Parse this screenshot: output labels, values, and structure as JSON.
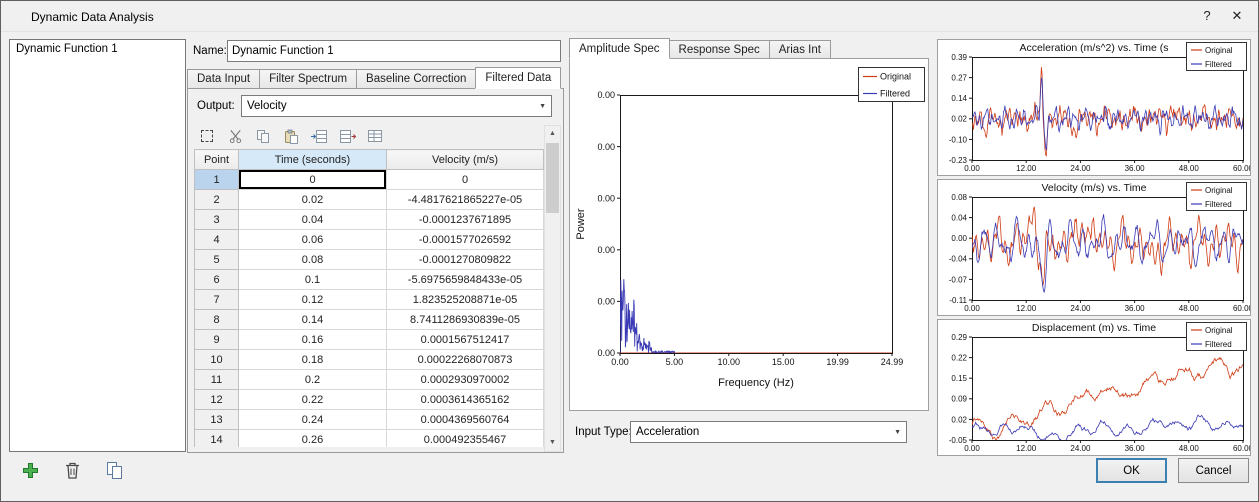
{
  "window": {
    "title": "Dynamic Data Analysis",
    "help": "?",
    "close": "✕"
  },
  "icons": {
    "chevron_down": "▼",
    "scroll_up": "▲",
    "scroll_down": "▼"
  },
  "sidebar": {
    "items": [
      {
        "label": "Dynamic Function 1"
      }
    ]
  },
  "form": {
    "name_label": "Name:",
    "name_value": "Dynamic Function 1",
    "tabs": [
      {
        "label": "Data Input"
      },
      {
        "label": "Filter Spectrum"
      },
      {
        "label": "Baseline Correction"
      },
      {
        "label": "Filtered Data"
      }
    ],
    "active_tab": "Filtered Data",
    "output_label": "Output:",
    "output_value": "Velocity"
  },
  "table": {
    "columns": [
      "Point",
      "Time (seconds)",
      "Velocity (m/s)"
    ],
    "rows": [
      [
        "1",
        "0",
        "0"
      ],
      [
        "2",
        "0.02",
        "-4.4817621865227e-05"
      ],
      [
        "3",
        "0.04",
        "-0.0001237671895"
      ],
      [
        "4",
        "0.06",
        "-0.0001577026592"
      ],
      [
        "5",
        "0.08",
        "-0.0001270809822"
      ],
      [
        "6",
        "0.1",
        "-5.6975659848433e-05"
      ],
      [
        "7",
        "0.12",
        "1.823525208871e-05"
      ],
      [
        "8",
        "0.14",
        "8.7411286930839e-05"
      ],
      [
        "9",
        "0.16",
        "0.0001567512417"
      ],
      [
        "10",
        "0.18",
        "0.00022268070873"
      ],
      [
        "11",
        "0.2",
        "0.0002930970002"
      ],
      [
        "12",
        "0.22",
        "0.0003614365162"
      ],
      [
        "13",
        "0.24",
        "0.0004369560764"
      ],
      [
        "14",
        "0.26",
        "0.000492355467"
      ]
    ]
  },
  "spec": {
    "tabs": [
      {
        "label": "Amplitude Spec"
      },
      {
        "label": "Response Spec"
      },
      {
        "label": "Arias Int"
      }
    ],
    "active_tab": "Amplitude Spec",
    "input_type_label": "Input Type:",
    "input_type_value": "Acceleration"
  },
  "buttons": {
    "ok": "OK",
    "cancel": "Cancel"
  },
  "chart_data": [
    {
      "id": "amplitude-spectrum",
      "type": "line",
      "title": "",
      "xlabel": "Frequency (Hz)",
      "ylabel": "Power",
      "x_tick_labels": [
        "0.00",
        "5.00",
        "10.00",
        "15.00",
        "19.99",
        "24.99"
      ],
      "y_tick_labels": [
        "0.00",
        "0.00",
        "0.00",
        "0.00",
        "0.00",
        "0.00"
      ],
      "xlim": [
        0,
        24.99
      ],
      "ylim": [
        0,
        1
      ],
      "legend_position": "top-right",
      "series": [
        {
          "name": "Original",
          "color": "#cf3c14",
          "gen": {
            "kind": "zero"
          }
        },
        {
          "name": "Filtered",
          "color": "#3939b5",
          "gen": {
            "kind": "spectrum",
            "seed": 9,
            "cutoff": 3.0,
            "decay": 1.0,
            "amp": 0.42
          }
        }
      ]
    },
    {
      "id": "acceleration-vs-time",
      "type": "line",
      "title": "Acceleration (m/s^2) vs. Time (s",
      "x_tick_labels": [
        "0.00",
        "12.00",
        "24.00",
        "36.00",
        "48.00",
        "60.00"
      ],
      "y_tick_labels": [
        "0.39",
        "0.27",
        "0.14",
        "0.02",
        "-0.10",
        "-0.23"
      ],
      "xlim": [
        0,
        60
      ],
      "ylim": [
        -0.23,
        0.39
      ],
      "legend_position": "top-right",
      "series": [
        {
          "name": "Original",
          "color": "#cf3c14",
          "gen": {
            "kind": "noise",
            "seed": 12,
            "base": 0.02,
            "amp": 0.05,
            "jitter": 0.022,
            "periods": [
              0.7,
              1.1,
              1.9,
              3.1,
              5.3
            ],
            "spikes": [
              [
                15.4,
                0.33,
                0.2
              ],
              [
                16.3,
                -0.2,
                0.25
              ],
              [
                23,
                -0.12,
                0.3
              ],
              [
                3,
                -0.1,
                0.3
              ],
              [
                44,
                0.1,
                0.3
              ]
            ]
          }
        },
        {
          "name": "Filtered",
          "color": "#3939b5",
          "gen": {
            "kind": "noise",
            "seed": 27,
            "base": 0.02,
            "amp": 0.045,
            "jitter": 0.018,
            "periods": [
              0.9,
              1.4,
              2.2,
              3.6
            ],
            "spikes": [
              [
                15.4,
                0.28,
                0.25
              ],
              [
                16.3,
                -0.17,
                0.3
              ]
            ]
          }
        }
      ]
    },
    {
      "id": "velocity-vs-time",
      "type": "line",
      "title": "Velocity (m/s) vs. Time",
      "x_tick_labels": [
        "0.00",
        "12.00",
        "24.00",
        "36.00",
        "48.00",
        "60.00"
      ],
      "y_tick_labels": [
        "0.08",
        "0.04",
        "0.00",
        "-0.04",
        "-0.07",
        "-0.11"
      ],
      "xlim": [
        0,
        60
      ],
      "ylim": [
        -0.11,
        0.08
      ],
      "legend_position": "top-right",
      "series": [
        {
          "name": "Original",
          "color": "#cf3c14",
          "gen": {
            "kind": "noise",
            "seed": 33,
            "base": -0.004,
            "amp": 0.03,
            "jitter": 0.006,
            "periods": [
              1.3,
              2.1,
              3.4,
              5.6
            ],
            "spikes": [
              [
                13.5,
                0.06,
                0.6
              ],
              [
                15.8,
                -0.085,
                0.5
              ],
              [
                25,
                0.05,
                0.7
              ],
              [
                40,
                -0.04,
                0.8
              ]
            ]
          }
        },
        {
          "name": "Filtered",
          "color": "#3939b5",
          "gen": {
            "kind": "noise",
            "seed": 44,
            "base": -0.004,
            "amp": 0.027,
            "jitter": 0.005,
            "periods": [
              1.5,
              2.4,
              3.8,
              6.0
            ],
            "spikes": [
              [
                15.8,
                -0.075,
                0.6
              ]
            ]
          }
        }
      ]
    },
    {
      "id": "displacement-vs-time",
      "type": "line",
      "title": "Displacement (m) vs. Time",
      "x_tick_labels": [
        "0.00",
        "12.00",
        "24.00",
        "36.00",
        "48.00",
        "60.00"
      ],
      "y_tick_labels": [
        "0.29",
        "0.22",
        "0.15",
        "0.09",
        "0.02",
        "-0.05"
      ],
      "xlim": [
        0,
        60
      ],
      "ylim": [
        -0.05,
        0.29
      ],
      "legend_position": "top-right",
      "series": [
        {
          "name": "Original",
          "color": "#cf3c14",
          "gen": {
            "kind": "trend",
            "seed": 55,
            "start": 0,
            "end": 0.22,
            "step": 0.016,
            "wig": 0.02,
            "period": 7.5
          }
        },
        {
          "name": "Filtered",
          "color": "#3939b5",
          "gen": {
            "kind": "trend",
            "seed": 66,
            "start": 0,
            "end": 0.03,
            "step": 0.012,
            "wig": 0.015,
            "period": 5.5
          }
        }
      ]
    }
  ]
}
